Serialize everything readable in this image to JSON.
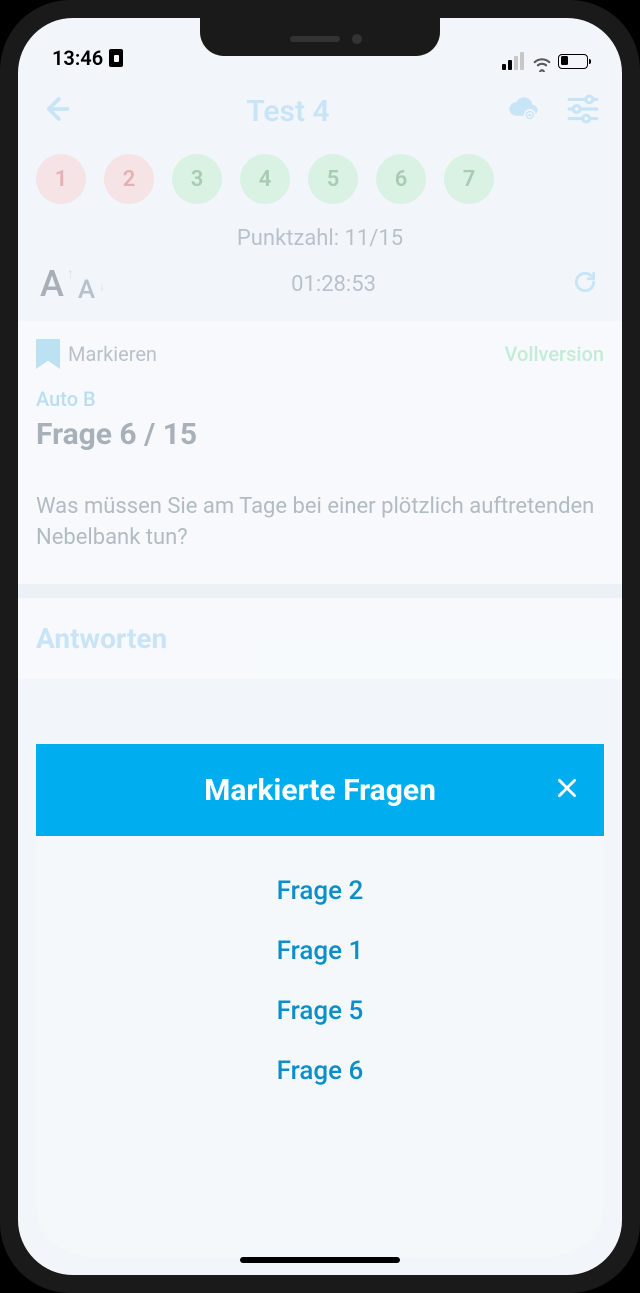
{
  "status": {
    "time": "13:46"
  },
  "header": {
    "title": "Test 4"
  },
  "numbers": [
    {
      "n": "1",
      "state": "wrong"
    },
    {
      "n": "2",
      "state": "wrong"
    },
    {
      "n": "3",
      "state": "right"
    },
    {
      "n": "4",
      "state": "right"
    },
    {
      "n": "5",
      "state": "right"
    },
    {
      "n": "6",
      "state": "right"
    },
    {
      "n": "7",
      "state": "right"
    }
  ],
  "score_label": "Punktzahl: 11/15",
  "timer": "01:28:53",
  "question": {
    "mark_label": "Markieren",
    "full_version": "Vollversion",
    "category": "Auto B",
    "counter": "Frage 6 / 15",
    "text": "Was müssen Sie am Tage bei einer plötzlich auftretenden Nebelbank tun?"
  },
  "answers_title": "Antworten",
  "sheet": {
    "title": "Markierte Fragen",
    "items": [
      "Frage 2",
      "Frage 1",
      "Frage 5",
      "Frage 6"
    ]
  }
}
